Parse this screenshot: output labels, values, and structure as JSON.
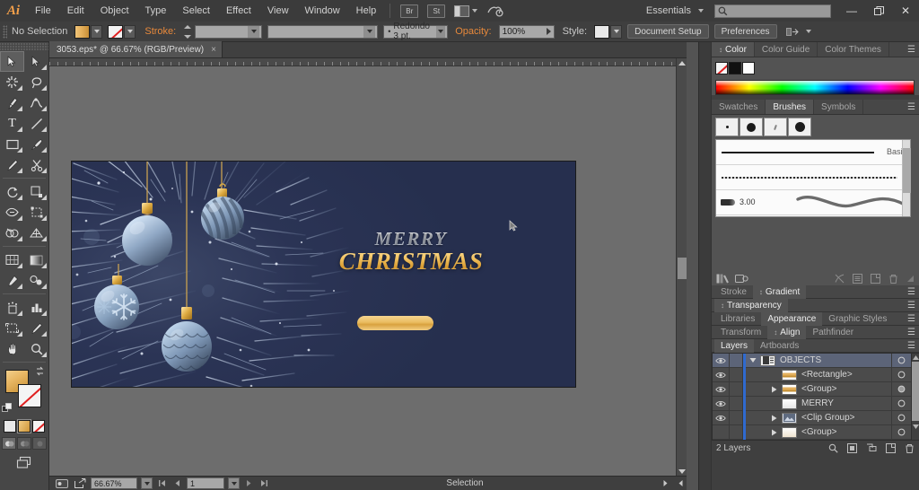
{
  "app": {
    "name": "Adobe Illustrator",
    "logo_text": "Ai"
  },
  "menubar": {
    "items": [
      "File",
      "Edit",
      "Object",
      "Type",
      "Select",
      "Effect",
      "View",
      "Window",
      "Help"
    ],
    "bridge_icon": "bridge-icon",
    "stock_icon": "stock-icon",
    "arrange_icon": "arrange-documents-icon",
    "cc_icon": "creative-cloud-icon",
    "workspace": "Essentials",
    "search_placeholder": "",
    "search_value": "",
    "minimize_label": "—",
    "restore_label": "❐",
    "close_label": "✕"
  },
  "controlbar": {
    "selection_status": "No Selection",
    "fill_label": "fill-swatch",
    "stroke_label": "Stroke:",
    "stroke_weight": "",
    "stroke_profile": "",
    "brush_definition": "Redondo 3 pt.",
    "opacity_label": "Opacity:",
    "opacity_value": "100%",
    "style_label": "Style:",
    "document_setup": "Document Setup",
    "preferences": "Preferences"
  },
  "document_tab": {
    "title": "3053.eps* @ 66.67% (RGB/Preview)",
    "close": "×"
  },
  "toolbar": {
    "tools": [
      "selection-tool",
      "direct-selection-tool",
      "magic-wand-tool",
      "lasso-tool",
      "pen-tool",
      "curvature-tool",
      "type-tool",
      "line-segment-tool",
      "rectangle-tool",
      "paintbrush-tool",
      "pencil-tool",
      "scissors-tool",
      "rotate-tool",
      "scale-tool",
      "width-tool",
      "free-transform-tool",
      "shape-builder-tool",
      "perspective-grid-tool",
      "mesh-tool",
      "gradient-tool",
      "eyedropper-tool",
      "blend-tool",
      "symbol-sprayer-tool",
      "column-graph-tool",
      "artboard-tool",
      "slice-tool",
      "hand-tool",
      "zoom-tool"
    ],
    "fill_swatch": "fill-color-gold",
    "stroke_swatch": "stroke-none",
    "color_modes": [
      "color-swatch-mode",
      "gradient-mode",
      "none-mode"
    ],
    "draw_modes": [
      "draw-normal",
      "draw-behind",
      "draw-inside"
    ],
    "screen_mode": "change-screen-mode"
  },
  "artwork": {
    "headline_top": "MERRY",
    "headline_bottom": "CHRISTMAS",
    "button_label": "",
    "background_color": "#26304f",
    "gold_color": "#e8b663"
  },
  "statusbar": {
    "zoom": "66.67%",
    "page": "1",
    "status": "Selection",
    "preview_icon": "preview-icon",
    "share_icon": "share-icon"
  },
  "panels": {
    "color_group": {
      "tabs": [
        "Color",
        "Color Guide",
        "Color Themes"
      ],
      "active": "Color",
      "swatches": [
        "none",
        "black",
        "white"
      ]
    },
    "brushes_group": {
      "tabs": [
        "Swatches",
        "Brushes",
        "Symbols"
      ],
      "active": "Brushes",
      "brush_rows": [
        {
          "name": "Basic",
          "type": "basic-stroke"
        },
        {
          "name": "",
          "type": "charcoal-stroke"
        },
        {
          "name": "3.00",
          "type": "bristle-brush"
        }
      ]
    },
    "stroke_gradient": {
      "tabs": [
        "Stroke",
        "Gradient"
      ],
      "active": "Gradient"
    },
    "transparency": {
      "tabs": [
        "Transparency"
      ],
      "active": "Transparency"
    },
    "appearance_group": {
      "tabs": [
        "Libraries",
        "Appearance",
        "Graphic Styles"
      ],
      "active": "Appearance"
    },
    "align_group": {
      "tabs": [
        "Transform",
        "Align",
        "Pathfinder"
      ],
      "active": "Align"
    },
    "layers_group": {
      "tabs": [
        "Layers",
        "Artboards"
      ],
      "active": "Layers",
      "rows": [
        {
          "name": "OBJECTS",
          "selected": true,
          "expanded": true,
          "indent": 0,
          "thumb": "layer-icon",
          "has_tri": true
        },
        {
          "name": "<Rectangle>",
          "selected": false,
          "expanded": false,
          "indent": 1,
          "thumb": "gold-bar",
          "has_tri": false
        },
        {
          "name": "<Group>",
          "selected": false,
          "expanded": false,
          "indent": 1,
          "thumb": "gold-bar",
          "has_tri": true
        },
        {
          "name": "MERRY",
          "selected": false,
          "expanded": false,
          "indent": 1,
          "thumb": "white-text",
          "has_tri": false
        },
        {
          "name": "<Clip Group>",
          "selected": false,
          "expanded": false,
          "indent": 1,
          "thumb": "image-thumb",
          "has_tri": true
        },
        {
          "name": "<Group>",
          "selected": false,
          "expanded": false,
          "indent": 1,
          "thumb": "pale-thumb",
          "has_tri": true
        }
      ],
      "footer_count": "2 Layers",
      "footer_icons": [
        "locate-object-icon",
        "make-mask-icon",
        "create-sublayer-icon",
        "new-layer-icon",
        "delete-layer-icon"
      ]
    }
  }
}
